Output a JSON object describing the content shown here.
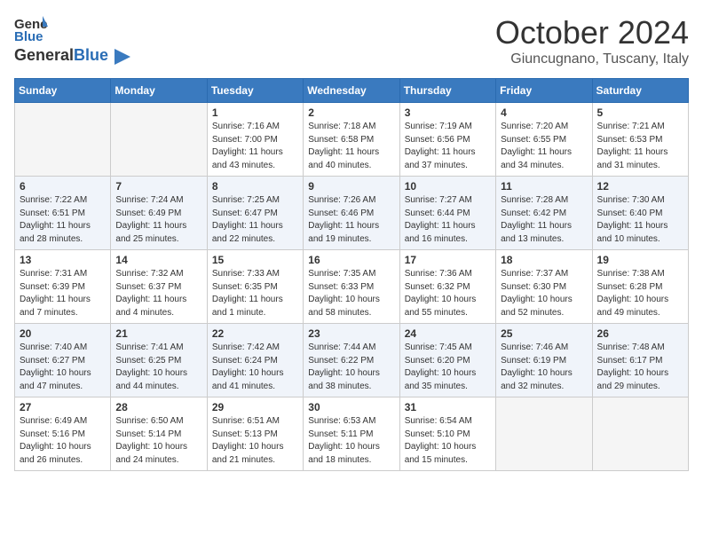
{
  "header": {
    "logo_general": "General",
    "logo_blue": "Blue",
    "month": "October 2024",
    "location": "Giuncugnano, Tuscany, Italy"
  },
  "weekdays": [
    "Sunday",
    "Monday",
    "Tuesday",
    "Wednesday",
    "Thursday",
    "Friday",
    "Saturday"
  ],
  "weeks": [
    [
      {
        "day": "",
        "info": ""
      },
      {
        "day": "",
        "info": ""
      },
      {
        "day": "1",
        "info": "Sunrise: 7:16 AM\nSunset: 7:00 PM\nDaylight: 11 hours and 43 minutes."
      },
      {
        "day": "2",
        "info": "Sunrise: 7:18 AM\nSunset: 6:58 PM\nDaylight: 11 hours and 40 minutes."
      },
      {
        "day": "3",
        "info": "Sunrise: 7:19 AM\nSunset: 6:56 PM\nDaylight: 11 hours and 37 minutes."
      },
      {
        "day": "4",
        "info": "Sunrise: 7:20 AM\nSunset: 6:55 PM\nDaylight: 11 hours and 34 minutes."
      },
      {
        "day": "5",
        "info": "Sunrise: 7:21 AM\nSunset: 6:53 PM\nDaylight: 11 hours and 31 minutes."
      }
    ],
    [
      {
        "day": "6",
        "info": "Sunrise: 7:22 AM\nSunset: 6:51 PM\nDaylight: 11 hours and 28 minutes."
      },
      {
        "day": "7",
        "info": "Sunrise: 7:24 AM\nSunset: 6:49 PM\nDaylight: 11 hours and 25 minutes."
      },
      {
        "day": "8",
        "info": "Sunrise: 7:25 AM\nSunset: 6:47 PM\nDaylight: 11 hours and 22 minutes."
      },
      {
        "day": "9",
        "info": "Sunrise: 7:26 AM\nSunset: 6:46 PM\nDaylight: 11 hours and 19 minutes."
      },
      {
        "day": "10",
        "info": "Sunrise: 7:27 AM\nSunset: 6:44 PM\nDaylight: 11 hours and 16 minutes."
      },
      {
        "day": "11",
        "info": "Sunrise: 7:28 AM\nSunset: 6:42 PM\nDaylight: 11 hours and 13 minutes."
      },
      {
        "day": "12",
        "info": "Sunrise: 7:30 AM\nSunset: 6:40 PM\nDaylight: 11 hours and 10 minutes."
      }
    ],
    [
      {
        "day": "13",
        "info": "Sunrise: 7:31 AM\nSunset: 6:39 PM\nDaylight: 11 hours and 7 minutes."
      },
      {
        "day": "14",
        "info": "Sunrise: 7:32 AM\nSunset: 6:37 PM\nDaylight: 11 hours and 4 minutes."
      },
      {
        "day": "15",
        "info": "Sunrise: 7:33 AM\nSunset: 6:35 PM\nDaylight: 11 hours and 1 minute."
      },
      {
        "day": "16",
        "info": "Sunrise: 7:35 AM\nSunset: 6:33 PM\nDaylight: 10 hours and 58 minutes."
      },
      {
        "day": "17",
        "info": "Sunrise: 7:36 AM\nSunset: 6:32 PM\nDaylight: 10 hours and 55 minutes."
      },
      {
        "day": "18",
        "info": "Sunrise: 7:37 AM\nSunset: 6:30 PM\nDaylight: 10 hours and 52 minutes."
      },
      {
        "day": "19",
        "info": "Sunrise: 7:38 AM\nSunset: 6:28 PM\nDaylight: 10 hours and 49 minutes."
      }
    ],
    [
      {
        "day": "20",
        "info": "Sunrise: 7:40 AM\nSunset: 6:27 PM\nDaylight: 10 hours and 47 minutes."
      },
      {
        "day": "21",
        "info": "Sunrise: 7:41 AM\nSunset: 6:25 PM\nDaylight: 10 hours and 44 minutes."
      },
      {
        "day": "22",
        "info": "Sunrise: 7:42 AM\nSunset: 6:24 PM\nDaylight: 10 hours and 41 minutes."
      },
      {
        "day": "23",
        "info": "Sunrise: 7:44 AM\nSunset: 6:22 PM\nDaylight: 10 hours and 38 minutes."
      },
      {
        "day": "24",
        "info": "Sunrise: 7:45 AM\nSunset: 6:20 PM\nDaylight: 10 hours and 35 minutes."
      },
      {
        "day": "25",
        "info": "Sunrise: 7:46 AM\nSunset: 6:19 PM\nDaylight: 10 hours and 32 minutes."
      },
      {
        "day": "26",
        "info": "Sunrise: 7:48 AM\nSunset: 6:17 PM\nDaylight: 10 hours and 29 minutes."
      }
    ],
    [
      {
        "day": "27",
        "info": "Sunrise: 6:49 AM\nSunset: 5:16 PM\nDaylight: 10 hours and 26 minutes."
      },
      {
        "day": "28",
        "info": "Sunrise: 6:50 AM\nSunset: 5:14 PM\nDaylight: 10 hours and 24 minutes."
      },
      {
        "day": "29",
        "info": "Sunrise: 6:51 AM\nSunset: 5:13 PM\nDaylight: 10 hours and 21 minutes."
      },
      {
        "day": "30",
        "info": "Sunrise: 6:53 AM\nSunset: 5:11 PM\nDaylight: 10 hours and 18 minutes."
      },
      {
        "day": "31",
        "info": "Sunrise: 6:54 AM\nSunset: 5:10 PM\nDaylight: 10 hours and 15 minutes."
      },
      {
        "day": "",
        "info": ""
      },
      {
        "day": "",
        "info": ""
      }
    ]
  ]
}
